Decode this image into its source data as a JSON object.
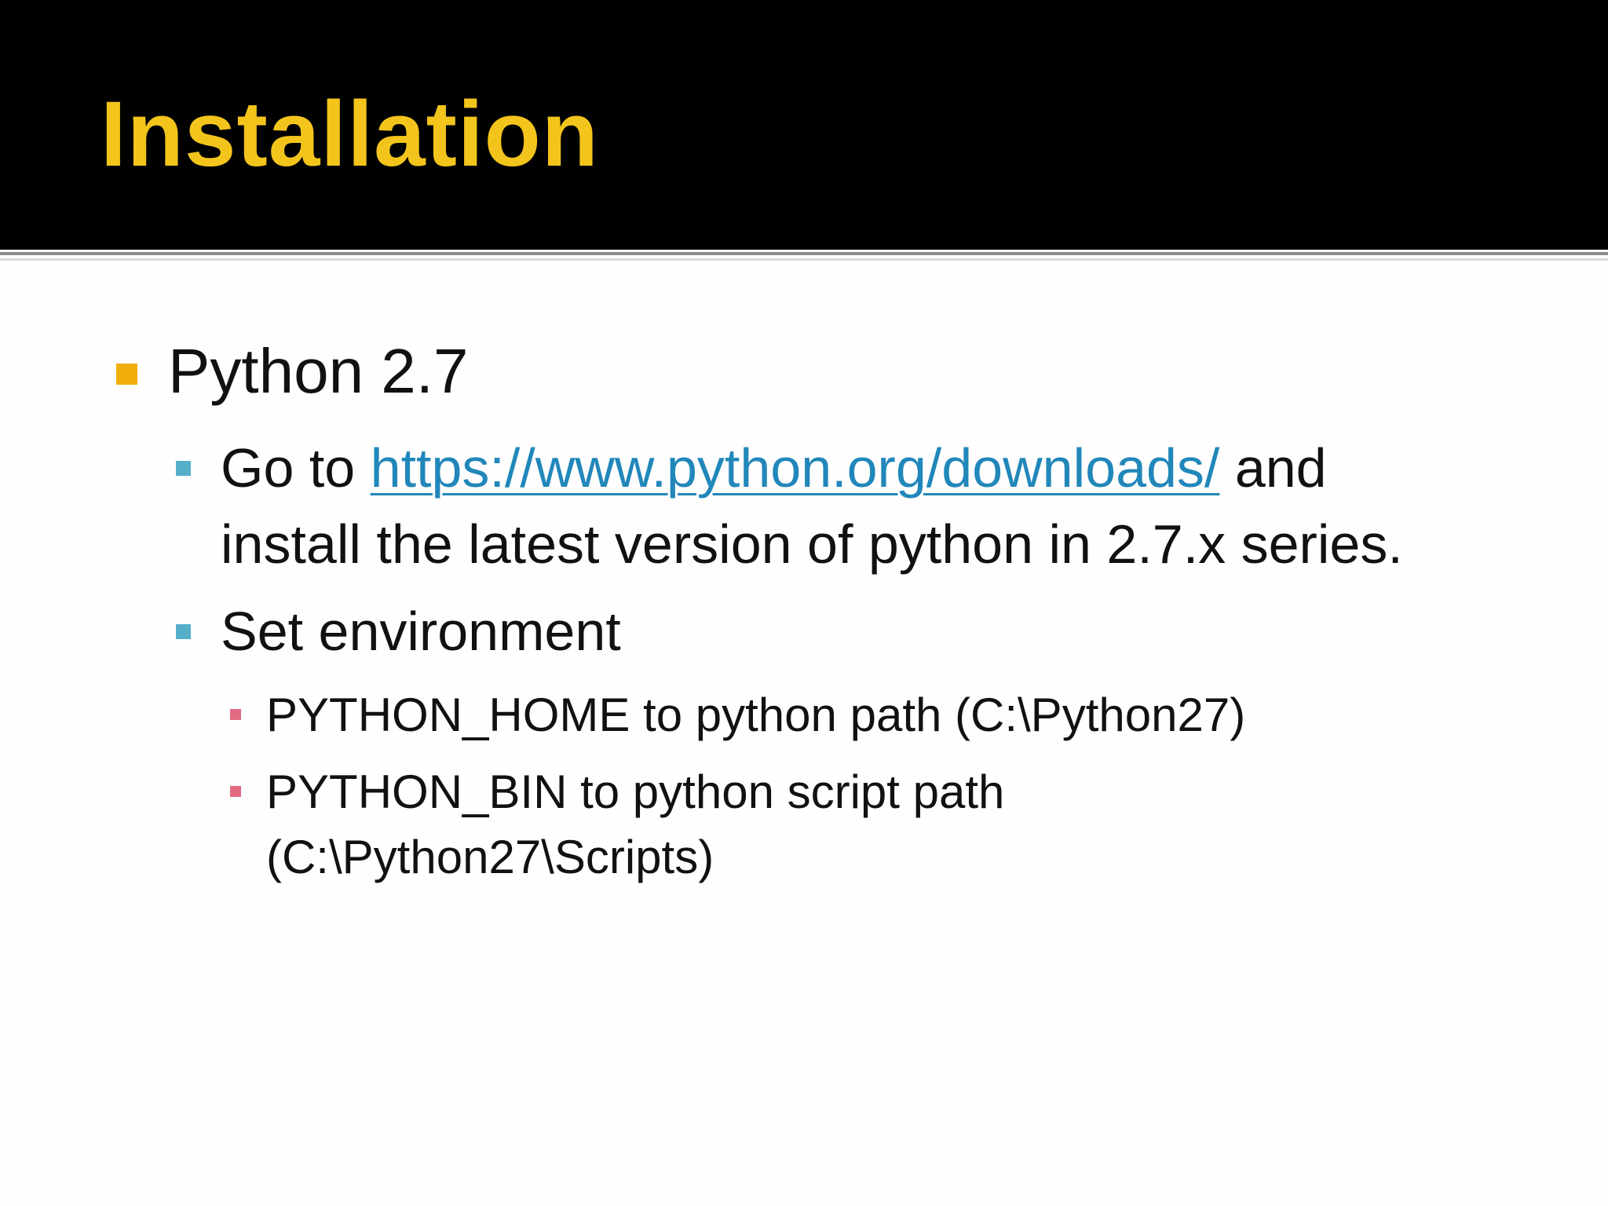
{
  "slide": {
    "title": "Installation",
    "items": [
      {
        "text": "Python 2.7",
        "children": [
          {
            "prefix": "Go to ",
            "link": "https://www.python.org/downloads/",
            "suffix": " and",
            "line2": "install the latest version of python in 2.7.x series."
          },
          {
            "text": "Set environment",
            "children": [
              {
                "text": "PYTHON_HOME to python path (C:\\Python27)"
              },
              {
                "line1": "PYTHON_BIN to python script path",
                "line2": "(C:\\Python27\\Scripts)"
              }
            ]
          }
        ]
      }
    ]
  },
  "colors": {
    "title": "#f3c51c",
    "title_bar": "#000000",
    "bullet_level1": "#f2ae0c",
    "bullet_level2": "#56afc9",
    "bullet_level3": "#e26b82",
    "link": "#2187ba"
  }
}
